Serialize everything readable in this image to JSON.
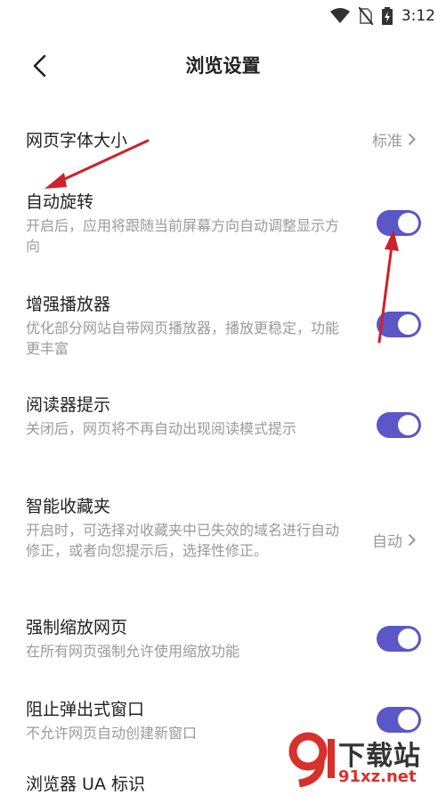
{
  "status_bar": {
    "time": "3:12"
  },
  "app_bar": {
    "title": "浏览设置",
    "back_icon": "chevron-left-icon"
  },
  "settings": [
    {
      "title": "网页字体大小",
      "value": "标准"
    },
    {
      "title": "自动旋转",
      "desc": "开启后，应用将跟随当前屏幕方向自动调整显示方向",
      "toggle": true
    },
    {
      "title": "增强播放器",
      "desc": "优化部分网站自带网页播放器，播放更稳定，功能更丰富",
      "toggle": true
    },
    {
      "title": "阅读器提示",
      "desc": "关闭后，网页将不再自动出现阅读模式提示",
      "toggle": true
    },
    {
      "title": "智能收藏夹",
      "desc": "开启时，可选择对收藏夹中已失效的域名进行自动修正，或者向您提示后，选择性修正。",
      "value": "自动"
    },
    {
      "title": "强制缩放网页",
      "desc": "在所有网页强制允许使用缩放功能",
      "toggle": true
    },
    {
      "title": "阻止弹出式窗口",
      "desc": "不允许网页自动创建新窗口",
      "toggle": true
    },
    {
      "title": "浏览器 UA 标识"
    }
  ],
  "colors": {
    "accent": "#5a57c7",
    "annotation_arrow": "#d0202a"
  },
  "watermark": {
    "text": "下载站",
    "url": "91xz.net"
  }
}
